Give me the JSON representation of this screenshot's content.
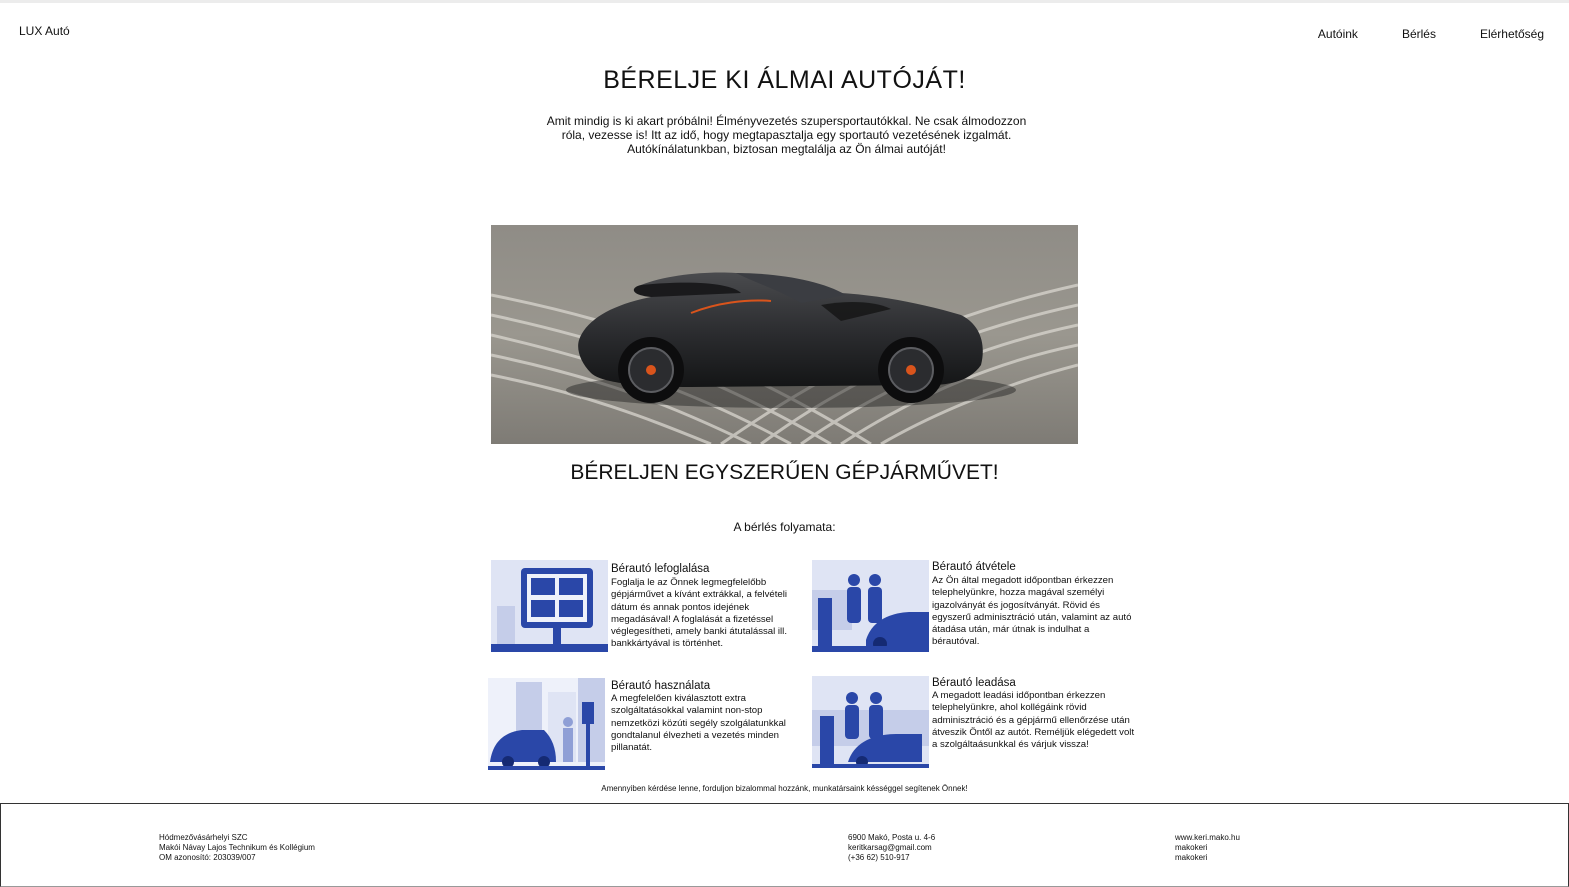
{
  "header": {
    "brand": "LUX Autó",
    "nav": [
      "Autóink",
      "Bérlés",
      "Elérhetőség"
    ]
  },
  "hero": {
    "title": "BÉRELJE KI ÁLMAI AUTÓJÁT!",
    "text": "Amit mindig is ki akart próbálni! Élményvezetés szupersportautókkal. Ne csak álmodozzon róla, vezesse is! Itt az idő, hogy megtapasztalja egy sportautó vezetésének izgalmát. Autókínálatunkban, biztosan megtalálja az Ön álmai autóját!"
  },
  "rental": {
    "title": "BÉRELJEN EGYSZERŰEN GÉPJÁRMŰVET!",
    "process_label": "A bérlés folyamata:",
    "steps": [
      {
        "title": "Bérautó lefoglalása",
        "text": "Foglalja le az Önnek legmegfelelőbb gépjárművet a kívánt extrákkal, a felvételi dátum és annak pontos idejének megadásával! A foglalását a fizetéssel véglegesítheti, amely banki átutalással ill. bankkártyával is történhet.",
        "icon": "booking-screen-icon"
      },
      {
        "title": "Bérautó átvétele",
        "text": "Az Ön által megadott időpontban érkezzen telephelyünkre, hozza magával személyi igazolványát és jogosítványát. Rövid és egyszerű adminisztráció után, valamint az autó átadása után, már útnak is indulhat a bérautóval.",
        "icon": "car-handover-icon"
      },
      {
        "title": "Bérautó használata",
        "text": "A megfelelően kiválasztott extra szolgáltatásokkal valamint non-stop nemzetközi közúti segély szolgálatunkkal gondtalanul élvezheti a vezetés minden pillanatát.",
        "icon": "city-driving-icon"
      },
      {
        "title": "Bérautó leadása",
        "text": "A megadott leadási időpontban érkezzen telephelyünkre, ahol kollégáink rövid adminisztráció és a gépjármű ellenőrzése után átveszik Öntől az autót. Reméljük elégedett volt a szolgáltaásunkkal és várjuk vissza!",
        "icon": "car-return-icon"
      }
    ],
    "footnote": "Amennyiben kérdése lenne, forduljon bizalommal hozzánk, munkatársaink késséggel segítenek Önnek!"
  },
  "footer": {
    "school": [
      "Hódmezővásárhelyi SZC",
      "Makói Návay Lajos Technikum és Kollégium",
      "OM azonosító: 203039/007"
    ],
    "contact": [
      "6900 Makó, Posta u. 4-6",
      "keritkarsag@gmail.com",
      "(+36 62) 510-917"
    ],
    "web": [
      "www.keri.mako.hu",
      "makokeri",
      "makokeri"
    ]
  },
  "colors": {
    "accent_blue": "#2a47a8",
    "light_blue": "#dfe4f4",
    "footer_border": "#333333"
  }
}
